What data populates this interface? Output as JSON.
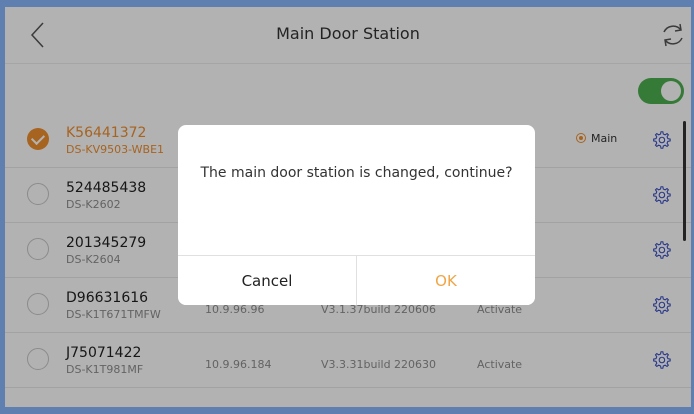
{
  "header": {
    "title": "Main Door Station",
    "back_icon": "chevron-left-icon",
    "refresh_icon": "refresh-icon"
  },
  "toolbar": {
    "toggle_on": true,
    "toggle_color": "#4caf50"
  },
  "list": {
    "accent_color": "#ef8f2f",
    "rows": [
      {
        "name": "K56441372",
        "model": "DS-KV9503-WBE1",
        "ip": "",
        "version": "",
        "status": "",
        "selected": true,
        "main_label": "Main"
      },
      {
        "name": "524485438",
        "model": "DS-K2602",
        "ip": "",
        "version": "",
        "status": "",
        "selected": false,
        "main_label": ""
      },
      {
        "name": "201345279",
        "model": "DS-K2604",
        "ip": "",
        "version": "",
        "status": "",
        "selected": false,
        "main_label": ""
      },
      {
        "name": "D96631616",
        "model": "DS-K1T671TMFW",
        "ip": "10.9.96.96",
        "version": "V3.1.37build 220606",
        "status": "Activate",
        "selected": false,
        "main_label": ""
      },
      {
        "name": "J75071422",
        "model": "DS-K1T981MF",
        "ip": "10.9.96.184",
        "version": "V3.3.31build 220630",
        "status": "Activate",
        "selected": false,
        "main_label": ""
      }
    ]
  },
  "dialog": {
    "message": "The main door station is changed, continue?",
    "cancel_label": "Cancel",
    "ok_label": "OK",
    "ok_color": "#f0a545"
  }
}
